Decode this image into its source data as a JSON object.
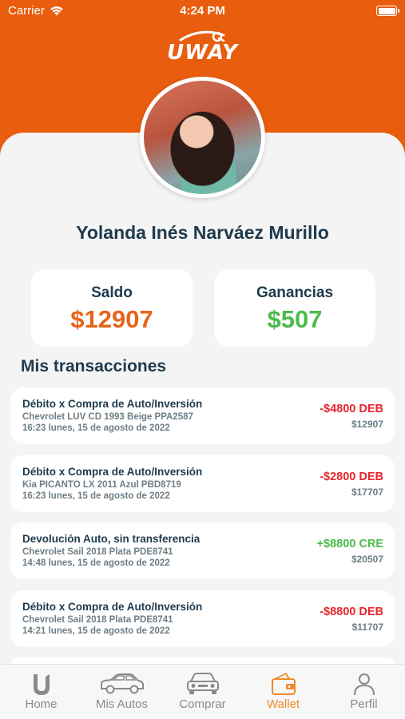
{
  "status": {
    "carrier": "Carrier",
    "time": "4:24 PM"
  },
  "brand": {
    "logo_text": "UWAY"
  },
  "profile": {
    "name": "Yolanda Inés Narváez Murillo"
  },
  "balances": {
    "saldo_label": "Saldo",
    "saldo_value": "$12907",
    "ganancias_label": "Ganancias",
    "ganancias_value": "$507"
  },
  "transactions_title": "Mis transacciones",
  "transactions": [
    {
      "title": "Débito x Compra de Auto/Inversión",
      "vehicle": "Chevrolet LUV CD 1993 Beige PPA2587",
      "date": "16:23 lunes, 15 de agosto de 2022",
      "amount": "-$4800 DEB",
      "balance": "$12907",
      "type": "debit"
    },
    {
      "title": "Débito x Compra de Auto/Inversión",
      "vehicle": "Kia PICANTO LX 2011 Azul PBD8719",
      "date": "16:23 lunes, 15 de agosto de 2022",
      "amount": "-$2800 DEB",
      "balance": "$17707",
      "type": "debit"
    },
    {
      "title": "Devolución Auto, sin transferencia",
      "vehicle": "Chevrolet Sail 2018 Plata PDE8741",
      "date": "14:48 lunes, 15 de agosto de 2022",
      "amount": "+$8800 CRE",
      "balance": "$20507",
      "type": "credit"
    },
    {
      "title": "Débito x Compra de Auto/Inversión",
      "vehicle": "Chevrolet Sail 2018 Plata PDE8741",
      "date": "14:21 lunes, 15 de agosto de 2022",
      "amount": "-$8800 DEB",
      "balance": "$11707",
      "type": "debit"
    }
  ],
  "tabs": [
    {
      "label": "Home",
      "icon": "home-icon"
    },
    {
      "label": "Mis Autos",
      "icon": "car-icon"
    },
    {
      "label": "Comprar",
      "icon": "car-front-icon"
    },
    {
      "label": "Wallet",
      "icon": "wallet-icon"
    },
    {
      "label": "Perfil",
      "icon": "person-icon"
    }
  ],
  "colors": {
    "brand_orange": "#e85d0e",
    "debit_red": "#e8262e",
    "credit_green": "#4cbb4c",
    "saldo_orange": "#e8641a",
    "ganancias_green": "#4cbb4c",
    "active_tab": "#f08a2a"
  }
}
